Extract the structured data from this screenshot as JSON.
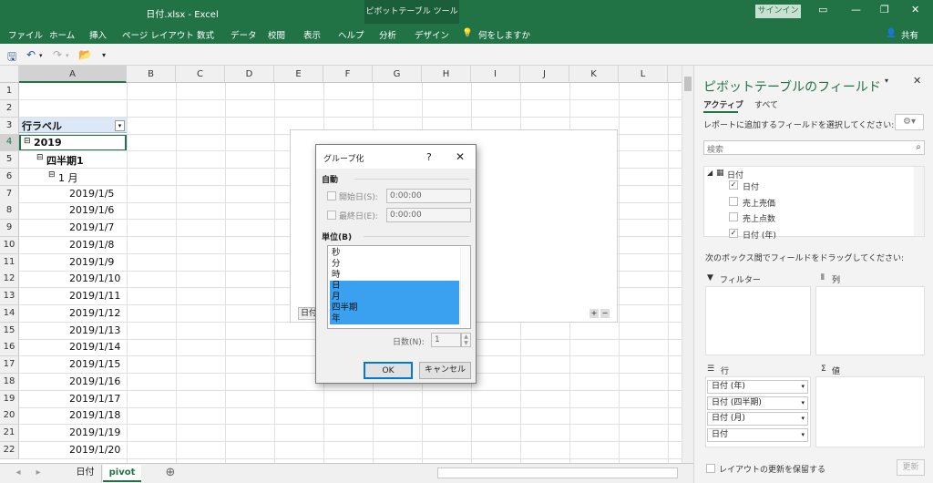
{
  "window": {
    "title": "日付.xlsx  -  Excel",
    "context_tab": "ピボットテーブル ツール",
    "signin": "サインイン"
  },
  "menu": {
    "items": [
      "ファイル",
      "ホーム",
      "挿入",
      "ページ レイアウト",
      "数式",
      "データ",
      "校閲",
      "表示",
      "ヘルプ",
      "分析",
      "デザイン",
      "何をしますか"
    ],
    "share": "共有"
  },
  "grid": {
    "columns": [
      "A",
      "B",
      "C",
      "D",
      "E",
      "F",
      "G",
      "H",
      "I",
      "J",
      "K",
      "L"
    ],
    "rows": [
      "1",
      "2",
      "3",
      "4",
      "5",
      "6",
      "7",
      "8",
      "9",
      "10",
      "11",
      "12",
      "13",
      "14",
      "15",
      "16",
      "17",
      "18",
      "19",
      "20",
      "21",
      "22"
    ],
    "cells": {
      "a3": "行ラベル",
      "a4": "2019",
      "a5": "四半期1",
      "a6": "1 月",
      "dates": [
        "2019/1/5",
        "2019/1/6",
        "2019/1/7",
        "2019/1/8",
        "2019/1/9",
        "2019/1/10",
        "2019/1/11",
        "2019/1/12",
        "2019/1/13",
        "2019/1/14",
        "2019/1/15",
        "2019/1/16",
        "2019/1/17",
        "2019/1/18",
        "2019/1/19",
        "2019/1/20"
      ]
    },
    "pivot_area_label": "日付"
  },
  "sheets": {
    "tabs": [
      "日付",
      "pivot"
    ],
    "active": "pivot"
  },
  "dialog": {
    "title": "グループ化",
    "help": "?",
    "close": "✕",
    "auto_label": "自動",
    "start_label": "開始日(S):",
    "start_value": "0:00:00",
    "end_label": "最終日(E):",
    "end_value": "0:00:00",
    "unit_label": "単位(B)",
    "units": [
      {
        "label": "秒",
        "selected": false
      },
      {
        "label": "分",
        "selected": false
      },
      {
        "label": "時",
        "selected": false
      },
      {
        "label": "日",
        "selected": true
      },
      {
        "label": "月",
        "selected": true
      },
      {
        "label": "四半期",
        "selected": true
      },
      {
        "label": "年",
        "selected": true
      }
    ],
    "days_label": "日数(N):",
    "days_value": "1",
    "ok": "OK",
    "cancel": "キャンセル"
  },
  "pane": {
    "title": "ピボットテーブルのフィールド",
    "tab_active": "アクティブ",
    "tab_all": "すべて",
    "instruction": "レポートに追加するフィールドを選択してください:",
    "search_placeholder": "検索",
    "table_name": "日付",
    "fields": [
      {
        "label": "日付",
        "checked": true
      },
      {
        "label": "売上売価",
        "checked": false
      },
      {
        "label": "売上点数",
        "checked": false
      },
      {
        "label": "日付 (年)",
        "checked": true
      }
    ],
    "drag_instruction": "次のボックス間でフィールドをドラッグしてください:",
    "area_filter": "フィルター",
    "area_columns": "列",
    "area_rows": "行",
    "area_values": "値",
    "row_fields": [
      "日付 (年)",
      "日付 (四半期)",
      "日付 (月)",
      "日付"
    ],
    "defer_label": "レイアウトの更新を保留する",
    "update_button": "更新"
  }
}
